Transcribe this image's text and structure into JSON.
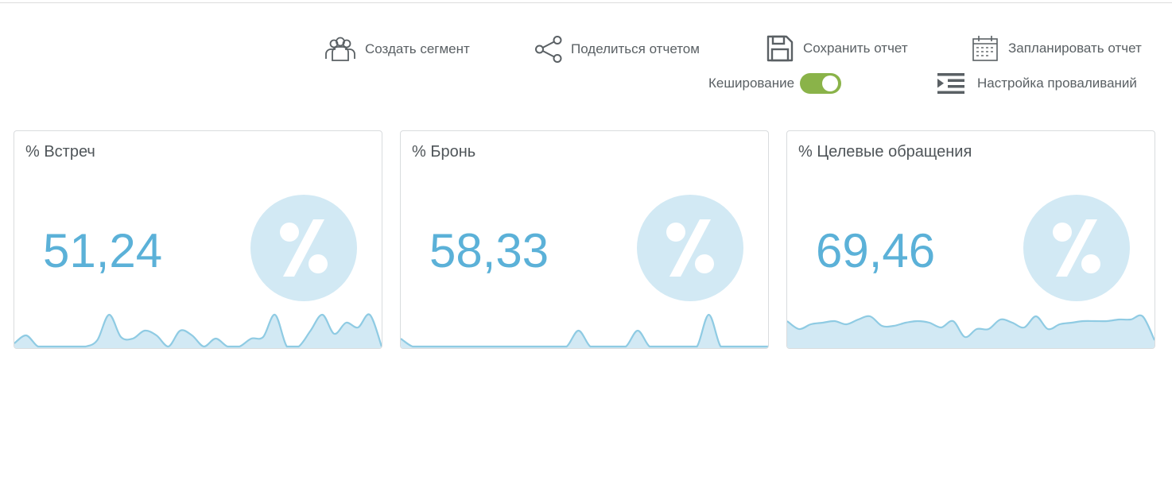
{
  "toolbar": {
    "create_segment": "Создать сегмент",
    "share_report": "Поделиться отчетом",
    "save_report": "Сохранить отчет",
    "schedule_report": "Запланировать отчет",
    "caching_label": "Кеширование",
    "caching_enabled": true,
    "drilldown_settings": "Настройка проваливаний"
  },
  "icons": {
    "create_segment": "users-group-icon",
    "share_report": "share-icon",
    "save_report": "floppy-disk-icon",
    "schedule_report": "calendar-icon",
    "drilldown_settings": "indent-list-icon",
    "card_badge": "percent-icon"
  },
  "colors": {
    "value_text": "#5bb1d8",
    "badge_bg": "#d2e9f4",
    "sparkline_stroke": "#8fcbe3",
    "sparkline_fill": "#d2e9f4",
    "toggle_on": "#8ab349"
  },
  "cards": [
    {
      "title": "% Встреч",
      "value": "51,24",
      "sparkline": [
        0.1,
        0.35,
        0,
        0,
        0,
        0,
        0,
        0.2,
        1,
        0.3,
        0.25,
        0.5,
        0.35,
        0,
        0.5,
        0.35,
        0,
        0.25,
        0,
        0,
        0.25,
        0.3,
        1,
        0,
        0,
        0.5,
        1,
        0.4,
        0.75,
        0.6,
        1,
        0
      ]
    },
    {
      "title": "% Бронь",
      "value": "58,33",
      "sparkline": [
        0.25,
        0,
        0,
        0,
        0,
        0,
        0,
        0,
        0,
        0,
        0,
        0,
        0,
        0,
        0,
        0.5,
        0,
        0,
        0,
        0,
        0.5,
        0,
        0,
        0,
        0,
        0,
        1,
        0,
        0,
        0,
        0,
        0
      ]
    },
    {
      "title": "% Целевые обращения",
      "value": "69,46",
      "sparkline": [
        0.8,
        0.55,
        0.7,
        0.75,
        0.8,
        0.7,
        0.85,
        0.95,
        0.65,
        0.65,
        0.75,
        0.8,
        0.75,
        0.6,
        0.8,
        0.3,
        0.55,
        0.55,
        0.85,
        0.75,
        0.6,
        0.95,
        0.55,
        0.7,
        0.75,
        0.8,
        0.8,
        0.8,
        0.85,
        0.85,
        0.95,
        0.2
      ]
    }
  ]
}
